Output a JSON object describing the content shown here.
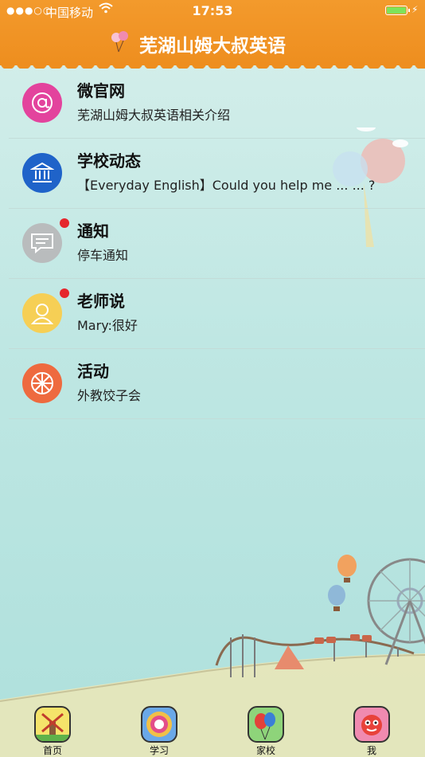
{
  "status_bar": {
    "signal": "●●●○○",
    "carrier": "中国移动",
    "time": "17:53"
  },
  "header": {
    "title": "芜湖山姆大叔英语"
  },
  "list": [
    {
      "title": "微官网",
      "subtitle": "芜湖山姆大叔英语相关介绍",
      "icon": "at-sign-icon",
      "color": "#e3439d",
      "badge": false
    },
    {
      "title": "学校动态",
      "subtitle": "【Everyday English】Could you help me ... ... ?",
      "icon": "building-icon",
      "color": "#1f63c9",
      "badge": false
    },
    {
      "title": "通知",
      "subtitle": "停车通知",
      "icon": "message-icon",
      "color": "#b9bcbd",
      "badge": true
    },
    {
      "title": "老师说",
      "subtitle": "Mary:很好",
      "icon": "teacher-icon",
      "color": "#f6cf55",
      "badge": true
    },
    {
      "title": "活动",
      "subtitle": "外教饺子会",
      "icon": "flower-icon",
      "color": "#ee6a3f",
      "badge": false
    }
  ],
  "tabs": [
    {
      "label": "首页",
      "icon": "windmill-icon"
    },
    {
      "label": "学习",
      "icon": "target-icon"
    },
    {
      "label": "家校",
      "icon": "balloons-icon"
    },
    {
      "label": "我",
      "icon": "monkey-face-icon"
    }
  ]
}
